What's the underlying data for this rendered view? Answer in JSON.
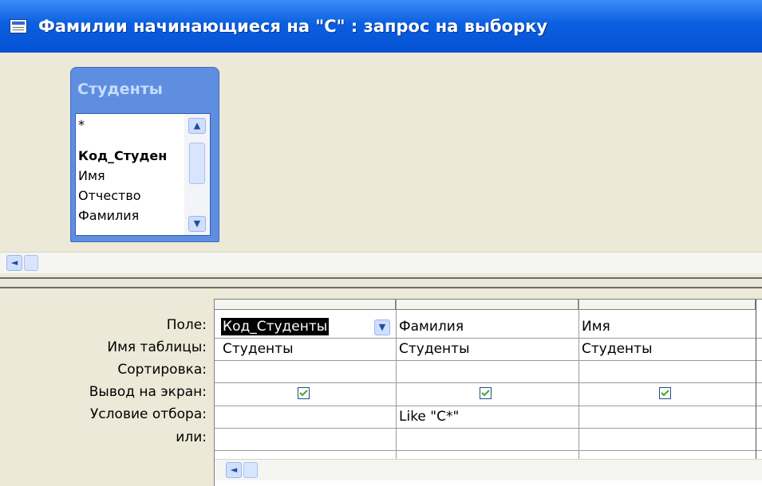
{
  "window": {
    "title": "Фамилии начинающиеся на \"С\" : запрос на выборку"
  },
  "table_list": {
    "name": "Студенты",
    "fields": [
      {
        "label": "*",
        "bold": false
      },
      {
        "label": "Код_Студен",
        "bold": true
      },
      {
        "label": "Имя",
        "bold": false
      },
      {
        "label": "Отчество",
        "bold": false
      },
      {
        "label": "Фамилия",
        "bold": false
      }
    ]
  },
  "icons": {
    "scroll_up": "▲",
    "scroll_down": "▼",
    "scroll_left": "◄",
    "dropdown": "▼"
  },
  "grid": {
    "row_labels": [
      "Поле:",
      "Имя таблицы:",
      "Сортировка:",
      "Вывод на экран:",
      "Условие отбора:",
      "или:"
    ],
    "columns": [
      {
        "field": "Код_Студенты",
        "table": "Студенты",
        "sort": "",
        "show": true,
        "criteria": "",
        "or": ""
      },
      {
        "field": "Фамилия",
        "table": "Студенты",
        "sort": "",
        "show": true,
        "criteria": "Like \"С*\"",
        "or": ""
      },
      {
        "field": "Имя",
        "table": "Студенты",
        "sort": "",
        "show": true,
        "criteria": "",
        "or": ""
      }
    ]
  },
  "colors": {
    "title_bar": "#0a5fe0",
    "checkbox_check": "#3fa629"
  }
}
